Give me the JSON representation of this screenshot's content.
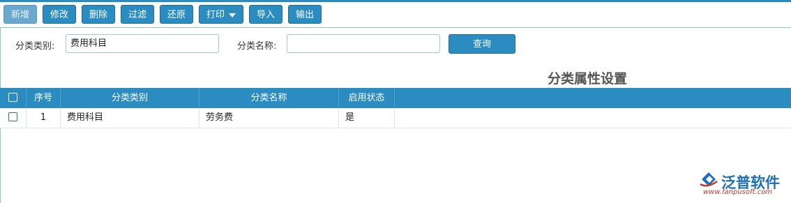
{
  "toolbar": {
    "new_label": "新增",
    "edit_label": "修改",
    "delete_label": "删除",
    "filter_label": "过滤",
    "restore_label": "还原",
    "print_label": "打印",
    "import_label": "导入",
    "export_label": "输出"
  },
  "filter": {
    "category_label": "分类类别:",
    "category_value": "费用科目",
    "name_label": "分类名称:",
    "name_value": "",
    "query_label": "查询"
  },
  "page_title": "分类属性设置",
  "table": {
    "headers": [
      "序号",
      "分类类别",
      "分类名称",
      "启用状态"
    ],
    "rows": [
      {
        "index": "1",
        "category": "费用科目",
        "name": "劳务费",
        "enabled": "是"
      }
    ]
  },
  "logo": {
    "brand": "泛普软件",
    "url": "www.fanpusoft.com"
  },
  "colors": {
    "accent": "#2b8cc2",
    "logo_blue": "#1f6fb3",
    "logo_red": "#c43a2a"
  }
}
